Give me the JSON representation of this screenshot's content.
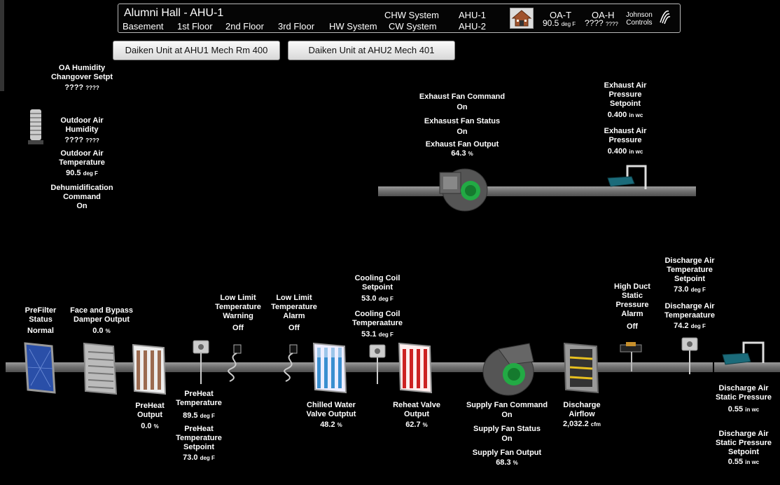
{
  "header": {
    "title": "Alumni Hall -  AHU-1",
    "links": [
      "Basement",
      "1st Floor",
      "2nd Floor",
      "3rd Floor",
      "HW System"
    ],
    "chw": "CHW System",
    "cw": "CW System",
    "ahu1": "AHU-1",
    "ahu2": "AHU-2",
    "oat_label": "OA-T",
    "oat_value": "90.5",
    "oat_unit": "deg F",
    "oah_label": "OA-H",
    "oah_value": "????",
    "oah_unit": "????",
    "logo_line1": "Johnson",
    "logo_line2": "Controls"
  },
  "buttons": {
    "unit1": "Daiken Unit at AHU1 Mech Rm 400",
    "unit2": "Daiken Unit at AHU2 Mech 401"
  },
  "outdoor": {
    "oa_hum_changeover_label": "OA Humidity Changover Setpt",
    "oa_hum_changeover_value": "????",
    "oa_hum_changeover_unit": "????",
    "oa_humidity_label": "Outdoor Air Humidity",
    "oa_humidity_value": "????",
    "oa_humidity_unit": "????",
    "oa_temp_label": "Outdoor Air Temperature",
    "oa_temp_value": "90.5",
    "oa_temp_unit": "deg F",
    "dehum_label": "Dehumidification Command",
    "dehum_value": "On"
  },
  "exhaust": {
    "cmd_label": "Exhaust Fan Command",
    "cmd_value": "On",
    "status_label": "Exhasust Fan Status",
    "status_value": "On",
    "output_label": "Exhaust Fan Output",
    "output_value": "64.3",
    "output_unit": "%",
    "press_sp_label": "Exhaust Air Pressure Setpoint",
    "press_sp_value": "0.400",
    "press_sp_unit": "in wc",
    "press_label": "Exhaust Air Pressure",
    "press_value": "0.400",
    "press_unit": "in wc"
  },
  "supply": {
    "prefilter_label": "PreFilter Status",
    "prefilter_value": "Normal",
    "damper_label": "Face and Bypass Damper Output",
    "damper_value": "0.0",
    "damper_unit": "%",
    "preheat_out_label": "PreHeat Output",
    "preheat_out_value": "0.0",
    "preheat_out_unit": "%",
    "preheat_temp_label": "PreHeat Temperature",
    "preheat_temp_value": "89.5",
    "preheat_temp_unit": "deg F",
    "preheat_sp_label": "PreHeat Temperature Setpoint",
    "preheat_sp_value": "73.0",
    "preheat_sp_unit": "deg F",
    "lowlimit_warn_label": "Low Limit Temperature Warning",
    "lowlimit_warn_value": "Off",
    "lowlimit_alarm_label": "Low Limit Temperature Alarm",
    "lowlimit_alarm_value": "Off",
    "cc_sp_label": "Cooling Coil Setpoint",
    "cc_sp_value": "53.0",
    "cc_sp_unit": "deg F",
    "cc_temp_label": "Cooling Coil Temperaature",
    "cc_temp_value": "53.1",
    "cc_temp_unit": "deg F",
    "chw_valve_label": "Chilled Water Valve Outptut",
    "chw_valve_value": "48.2",
    "chw_valve_unit": "%",
    "reheat_label": "Reheat Valve Output",
    "reheat_value": "62.7",
    "reheat_unit": "%",
    "sf_cmd_label": "Supply Fan Command",
    "sf_cmd_value": "On",
    "sf_status_label": "Supply Fan Status",
    "sf_status_value": "On",
    "sf_output_label": "Supply Fan Output",
    "sf_output_value": "68.3",
    "sf_output_unit": "%",
    "airflow_label": "Discharge Airflow",
    "airflow_value": "2,032.2",
    "airflow_unit": "cfm",
    "hi_duct_label": "High Duct Static Pressure Alarm",
    "hi_duct_value": "Off",
    "da_temp_sp_label": "Discharge Air Temperature Setpoint",
    "da_temp_sp_value": "73.0",
    "da_temp_sp_unit": "deg F",
    "da_temp_label": "Discharge Air Temperaature",
    "da_temp_value": "74.2",
    "da_temp_unit": "deg F",
    "da_static_label": "Discharge Air Static Pressure",
    "da_static_value": "0.55",
    "da_static_unit": "in wc",
    "da_static_sp_label": "Discharge Air Static Pressure Setpoint",
    "da_static_sp_value": "0.55",
    "da_static_sp_unit": "in wc"
  },
  "colors": {
    "background": "#000000",
    "duct": "#7a7a7a",
    "fan_green": "#22aa44",
    "filter_blue": "#2a4fa8",
    "reheat_red": "#cc2222",
    "chw_blue": "#3a8fd0"
  },
  "icons": [
    "home-icon",
    "johnson-controls-logo",
    "outdoor-sensor-icon",
    "exhaust-fan-icon",
    "pressure-sensor-icon",
    "filter-icon",
    "damper-icon",
    "preheat-coil-icon",
    "temp-sensor-icon",
    "freezestat-icon",
    "cooling-coil-icon",
    "reheat-coil-icon",
    "supply-fan-icon",
    "airflow-station-icon",
    "pressure-switch-icon"
  ]
}
